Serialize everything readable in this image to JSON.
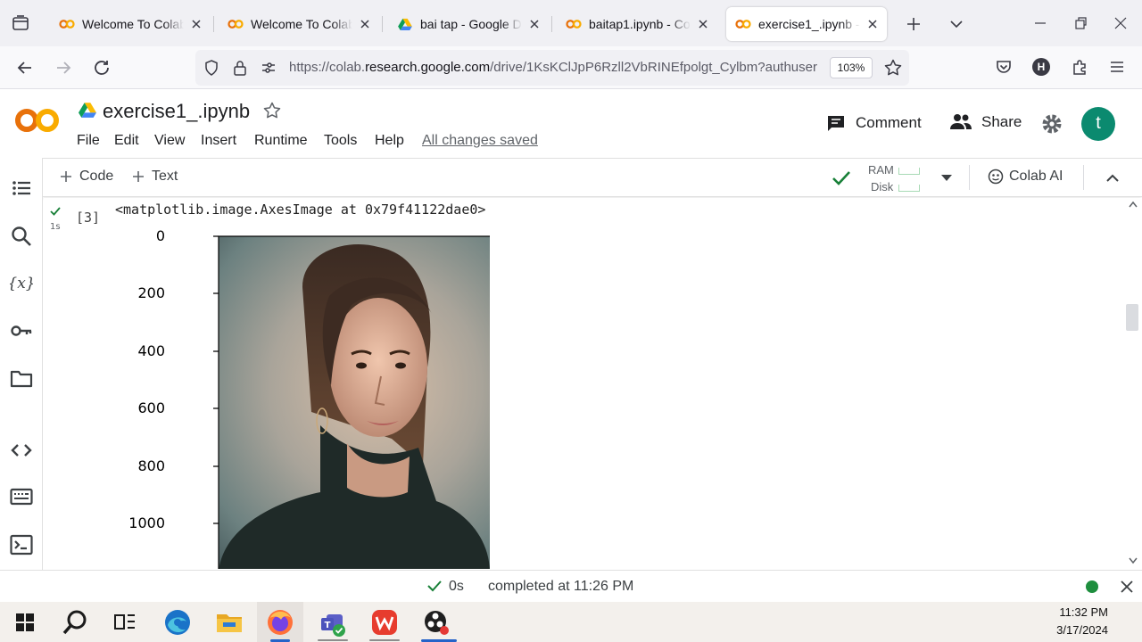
{
  "browser": {
    "tabs": [
      {
        "label": "Welcome To Colaboratory",
        "favicon": "colab-icon",
        "active": false
      },
      {
        "label": "Welcome To Colaboratory",
        "favicon": "colab-icon",
        "active": false
      },
      {
        "label": "bai tap - Google Drive",
        "favicon": "google-drive-icon",
        "active": false
      },
      {
        "label": "baitap1.ipynb - Colab",
        "favicon": "colab-icon",
        "active": false
      },
      {
        "label": "exercise1_.ipynb - Colab",
        "favicon": "colab-icon",
        "active": true
      }
    ],
    "url_prefix": "https://colab.",
    "url_domain": "research.google.com",
    "url_path": "/drive/1KsKClJpP6Rzll2VbRINEfpolgt_Cylbm?authuser",
    "zoom": "103%",
    "profile_initial": "H"
  },
  "colab": {
    "title": "exercise1_.ipynb",
    "menu": [
      "File",
      "Edit",
      "View",
      "Insert",
      "Runtime",
      "Tools",
      "Help"
    ],
    "save_status": "All changes saved",
    "comment_label": "Comment",
    "share_label": "Share",
    "avatar_initial": "t",
    "toolbar": {
      "code_label": "Code",
      "text_label": "Text",
      "ram_label": "RAM",
      "disk_label": "Disk",
      "colab_ai_label": "Colab AI"
    }
  },
  "cell": {
    "execution_count": "[3]",
    "run_time": "1s",
    "output_repr": "<matplotlib.image.AxesImage at 0x79f41122dae0>",
    "y_ticks": [
      "0",
      "200",
      "400",
      "600",
      "800",
      "1000"
    ]
  },
  "status_bar": {
    "elapsed": "0s",
    "message": "completed at 11:26 PM"
  },
  "taskbar": {
    "time": "11:32 PM",
    "date": "3/17/2024"
  },
  "colors": {
    "colab_orange": "#f9ab00",
    "success_green": "#188038",
    "avatar_teal": "#0b8a6f",
    "taskbar_bg": "#f3f0ec"
  }
}
